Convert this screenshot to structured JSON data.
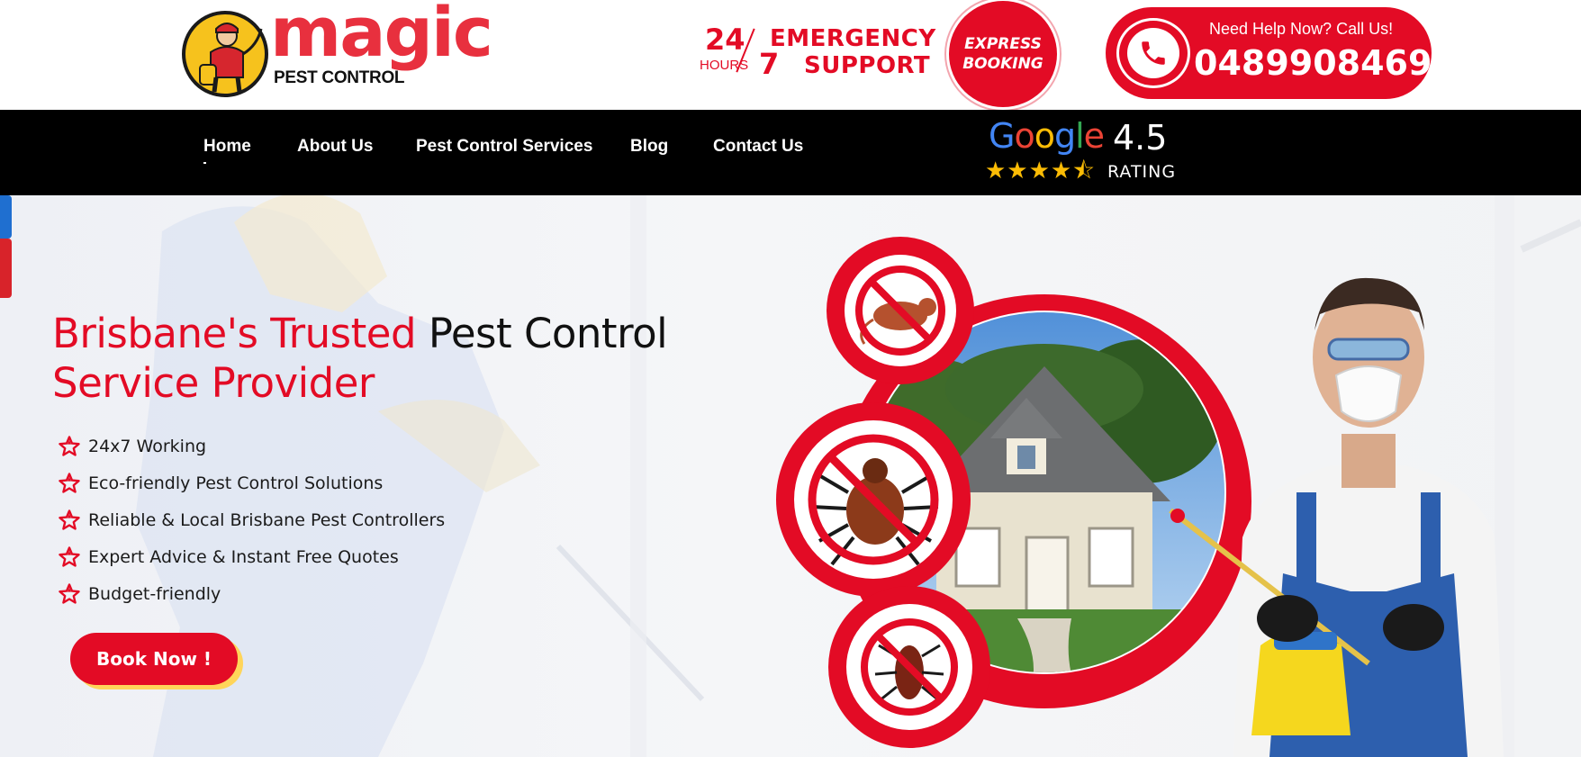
{
  "brand": {
    "logo_word": "magic",
    "logo_sub": "PEST CONTROL"
  },
  "emergency": {
    "hours_number": "24",
    "hours_label": "HOURS",
    "days_number": "7",
    "line1": "EMERGENCY",
    "line2": "SUPPORT"
  },
  "express_booking": {
    "line1": "EXPRESS",
    "line2": "BOOKING"
  },
  "call": {
    "label": "Need Help Now? Call Us!",
    "number": "0489908469",
    "icon": "phone-icon"
  },
  "nav": {
    "items": [
      {
        "label": "Home"
      },
      {
        "label": "About Us"
      },
      {
        "label": "Pest Control Services"
      },
      {
        "label": "Blog"
      },
      {
        "label": "Contact Us"
      }
    ]
  },
  "google_rating": {
    "word": "Google",
    "score": "4.5",
    "stars": "★★★★⯪",
    "label": "RATING",
    "rating_value": 4.5,
    "rating_max": 5
  },
  "hero": {
    "title_red": "Brisbane's Trusted",
    "title_black": "Pest Control",
    "title_line2": "Service Provider",
    "features": [
      {
        "text": "24x7 Working"
      },
      {
        "text": "Eco-friendly Pest Control Solutions"
      },
      {
        "text": "Reliable & Local Brisbane Pest Controllers"
      },
      {
        "text": "Expert Advice & Instant Free Quotes"
      },
      {
        "text": "Budget-friendly"
      }
    ],
    "cta_label": "Book Now !"
  },
  "colors": {
    "brand_red": "#e30b25",
    "nav_bg": "#000000",
    "cta_shadow": "#ffd55a"
  }
}
